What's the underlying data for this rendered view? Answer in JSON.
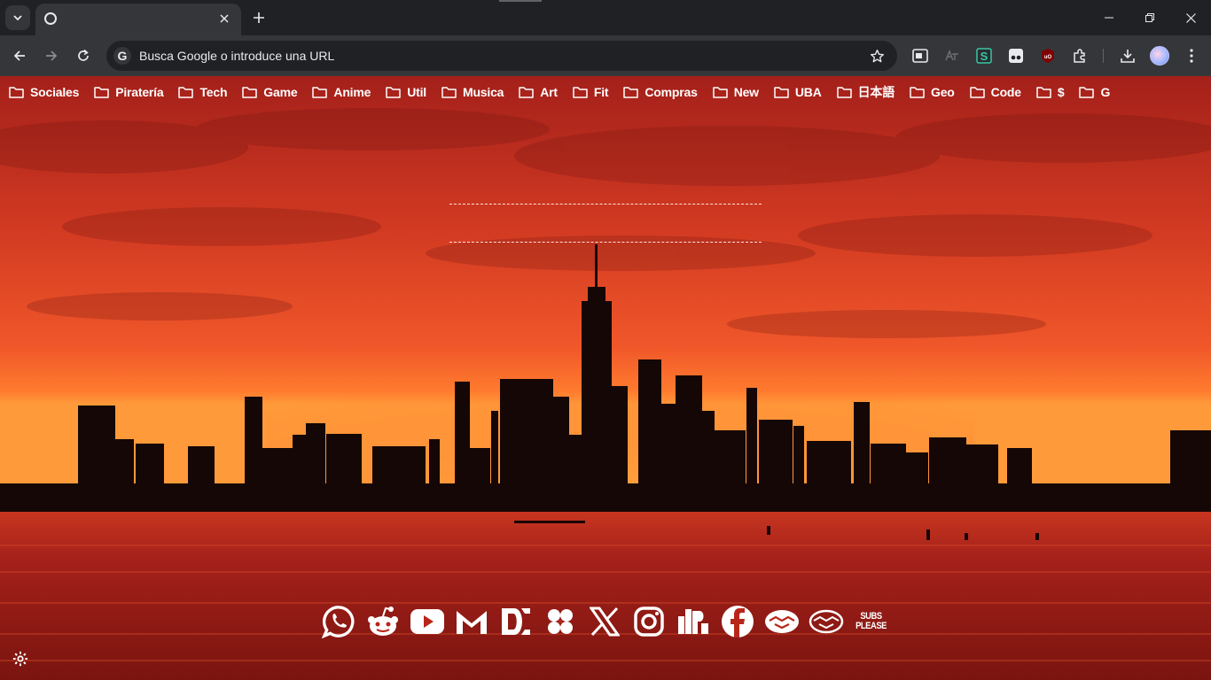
{
  "browser": {
    "tab": {
      "title": "",
      "close_icon": "close-icon"
    },
    "omnibox": {
      "placeholder": "Busca Google o introduce una URL"
    }
  },
  "bookmarks": [
    {
      "label": "Sociales"
    },
    {
      "label": "Piratería"
    },
    {
      "label": "Tech"
    },
    {
      "label": "Game"
    },
    {
      "label": "Anime"
    },
    {
      "label": "Util"
    },
    {
      "label": "Musica"
    },
    {
      "label": "Art"
    },
    {
      "label": "Fit"
    },
    {
      "label": "Compras"
    },
    {
      "label": "New"
    },
    {
      "label": "UBA"
    },
    {
      "label": "日本語"
    },
    {
      "label": "Geo"
    },
    {
      "label": "Code"
    },
    {
      "label": "$"
    },
    {
      "label": "G"
    }
  ],
  "social_links": [
    {
      "icon": "whatsapp-icon"
    },
    {
      "icon": "reddit-icon"
    },
    {
      "icon": "youtube-icon"
    },
    {
      "icon": "gmail-icon"
    },
    {
      "icon": "deviantart-like-icon"
    },
    {
      "icon": "clover-icon"
    },
    {
      "icon": "x-icon"
    },
    {
      "icon": "instagram-icon"
    },
    {
      "icon": "jps-icon"
    },
    {
      "icon": "facebook-icon"
    },
    {
      "icon": "mercadolibre-icon"
    },
    {
      "icon": "mercadolibre-outline-icon"
    },
    {
      "icon": "subsplease-icon",
      "text_line1": "SUBS",
      "text_line2": "PLEASE"
    }
  ],
  "colors": {
    "chrome_dark": "#202124",
    "chrome_toolbar": "#35363a",
    "sky_top": "#b3241a",
    "sky_horizon": "#ff7a2a",
    "water": "#9c1a14",
    "skyline": "#140606"
  }
}
